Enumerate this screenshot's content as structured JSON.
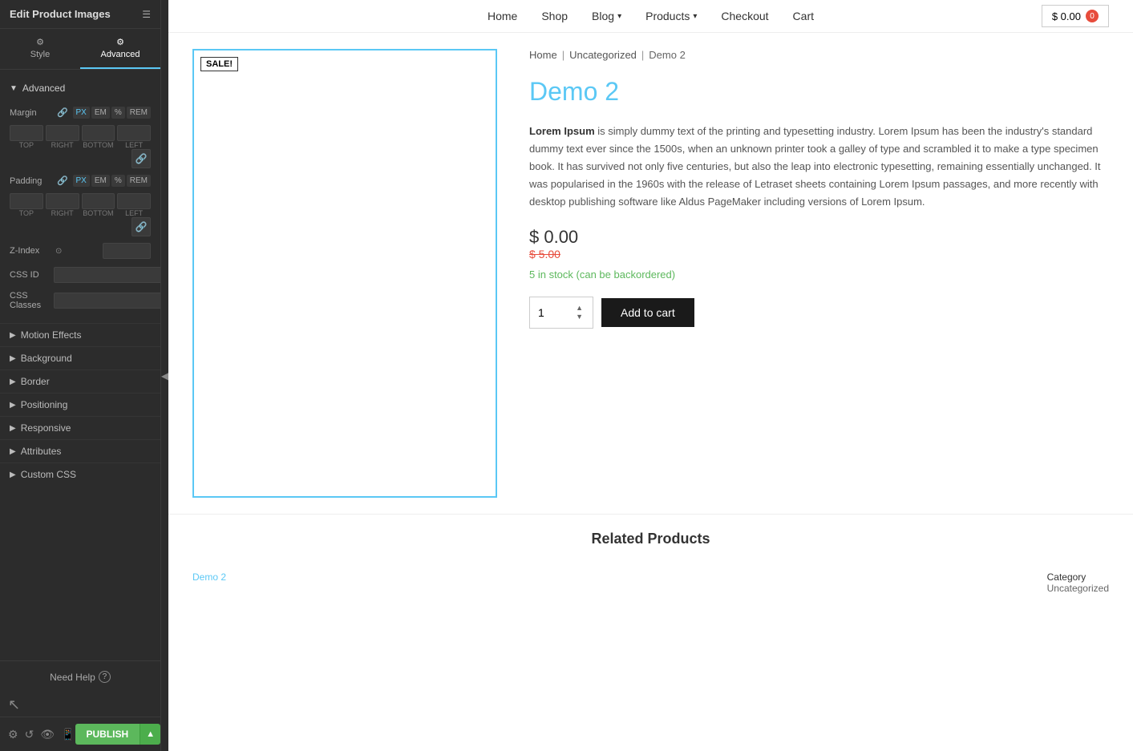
{
  "panel": {
    "title": "Edit Product Images",
    "tabs": [
      {
        "id": "style",
        "label": "Style",
        "icon": "⚙"
      },
      {
        "id": "advanced",
        "label": "Advanced",
        "icon": "⚙"
      }
    ],
    "active_tab": "advanced",
    "sections": {
      "advanced": {
        "label": "Advanced",
        "expanded": true
      },
      "margin": {
        "label": "Margin",
        "unit_options": [
          "PX",
          "EM",
          "%",
          "REM"
        ],
        "active_unit": "PX",
        "values": {
          "top": "",
          "right": "",
          "bottom": "",
          "left": ""
        },
        "labels": [
          "TOP",
          "RIGHT",
          "BOTTOM",
          "LEFT"
        ]
      },
      "padding": {
        "label": "Padding",
        "unit_options": [
          "PX",
          "EM",
          "%",
          "REM"
        ],
        "active_unit": "PX",
        "values": {
          "top": "",
          "right": "",
          "bottom": "",
          "left": ""
        },
        "labels": [
          "TOP",
          "RIGHT",
          "BOTTOM",
          "LEFT"
        ]
      },
      "zindex": {
        "label": "Z-Index"
      },
      "css_id": {
        "label": "CSS ID"
      },
      "css_classes": {
        "label": "CSS Classes"
      },
      "motion_effects": {
        "label": "Motion Effects"
      },
      "background": {
        "label": "Background"
      },
      "border": {
        "label": "Border"
      },
      "positioning": {
        "label": "Positioning"
      },
      "responsive": {
        "label": "Responsive"
      },
      "attributes": {
        "label": "Attributes"
      },
      "custom_css": {
        "label": "Custom CSS"
      }
    },
    "footer": {
      "need_help": "Need Help",
      "publish_label": "PUBLISH"
    }
  },
  "nav": {
    "items": [
      {
        "label": "Home"
      },
      {
        "label": "Shop"
      },
      {
        "label": "Blog",
        "has_dropdown": true
      },
      {
        "label": "Products",
        "has_dropdown": true
      },
      {
        "label": "Checkout"
      },
      {
        "label": "Cart"
      }
    ],
    "cart": {
      "amount": "$ 0.00",
      "count": "0"
    }
  },
  "product": {
    "sale_badge": "SALE!",
    "breadcrumb": {
      "home": "Home",
      "category": "Uncategorized",
      "current": "Demo 2"
    },
    "title": "Demo 2",
    "description": "Lorem Ipsum is simply dummy text of the printing and typesetting industry. Lorem Ipsum has been the industry's standard dummy text ever since the 1500s, when an unknown printer took a galley of type and scrambled it to make a type specimen book. It has survived not only five centuries, but also the leap into electronic typesetting, remaining essentially unchanged. It was popularised in the 1960s with the release of Letraset sheets containing Lorem Ipsum passages, and more recently with desktop publishing software like Aldus PageMaker including versions of Lorem Ipsum.",
    "description_bold_start": "Lorem Ipsum",
    "price": "$ 0.00",
    "original_price": "$ 5.00",
    "stock": "5 in stock (can be backordered)",
    "quantity": "1",
    "add_to_cart": "Add to cart",
    "meta": {
      "tag_label": "Demo 2",
      "category_label": "Category",
      "category_value": "Uncategorized"
    }
  },
  "related": {
    "title": "Related Products"
  }
}
